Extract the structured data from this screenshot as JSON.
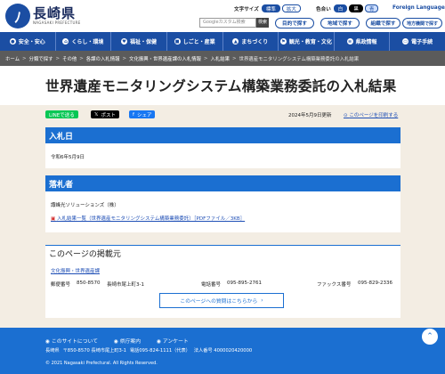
{
  "header": {
    "logo_mark": "ﾉ",
    "logo_jp": "長崎県",
    "logo_en": "NAGASAKI PREFECTURE",
    "font_size_label": "文字サイズ",
    "font_standard": "標準",
    "font_large": "拡大",
    "bg_color_label": "色合い",
    "color_white": "白",
    "color_black": "黒",
    "color_blue": "青",
    "foreign_language": "Foreign Language",
    "search_placeholder": "Googleカスタム検索",
    "search_button": "検索",
    "purpose_button": "目的で探す",
    "region_button": "地域で探す",
    "org_button": "組織で探す",
    "local_button": "地方機関で探す"
  },
  "nav": {
    "items": [
      {
        "label": "安全・安心",
        "icon": "shield-icon"
      },
      {
        "label": "くらし・環境",
        "icon": "home-icon"
      },
      {
        "label": "福祉・保健",
        "icon": "heart-icon"
      },
      {
        "label": "しごと・産業",
        "icon": "briefcase-icon"
      },
      {
        "label": "まちづくり",
        "icon": "building-icon"
      },
      {
        "label": "観光・教育・文化",
        "icon": "flag-icon"
      },
      {
        "label": "県政情報",
        "icon": "document-icon"
      },
      {
        "label": "電子手続",
        "icon": "computer-icon"
      }
    ]
  },
  "breadcrumb": [
    "ホーム",
    "分類で探す",
    "その他",
    "各課の入札情報",
    "文化振興・世界遺産課の入札情報",
    "入札結果",
    "世界遺産モニタリングシステム構築業務委託の入札結果"
  ],
  "page_title": "世界遺産モニタリングシステム構築業務委託の入札結果",
  "share": {
    "line": "LINEで送る",
    "x": "ポスト",
    "facebook": "シェア"
  },
  "updated": "2024年5月9日更新",
  "print_link": "このページを印刷する",
  "bid_date": {
    "heading": "入札日",
    "value": "令和6年5月9日"
  },
  "winner": {
    "heading": "落札者",
    "value": "諏峰光ソリューションズ（株）",
    "link": "入札結果一覧（世界遺産モニタリングシステム構築業務委託）［PDFファイル／3KB］"
  },
  "contact": {
    "heading": "このページの掲載元",
    "dept": "文化振興・世界遺産課",
    "postal_label": "郵便番号",
    "postal_value": "850-8570",
    "address": "長崎市尾上町3-1",
    "phone_label": "電話番号",
    "phone_value": "095-895-2761",
    "fax_label": "ファックス番号",
    "fax_value": "095-829-2336",
    "inquiry_button": "このページへの質問はこちらから"
  },
  "footer": {
    "about": "このサイトについて",
    "directions": "県庁案内",
    "survey": "アンケート",
    "org": "長崎県",
    "address": "〒850-8570 長崎市尾上町3-1",
    "phone": "電話095-824-1111（代表）",
    "corp_no": "法人番号 4000020420000",
    "copyright": "© 2021 Nagasaki Prefectural. All Rights Reserved."
  },
  "colors": {
    "brand": "#1b4ea3",
    "section_blue": "#1b6fd1",
    "page_bg": "#f3ede3",
    "breadcrumb_bg": "#5b5b5b",
    "line_green": "#06c755",
    "x_black": "#000000",
    "facebook_blue": "#1877f2"
  }
}
